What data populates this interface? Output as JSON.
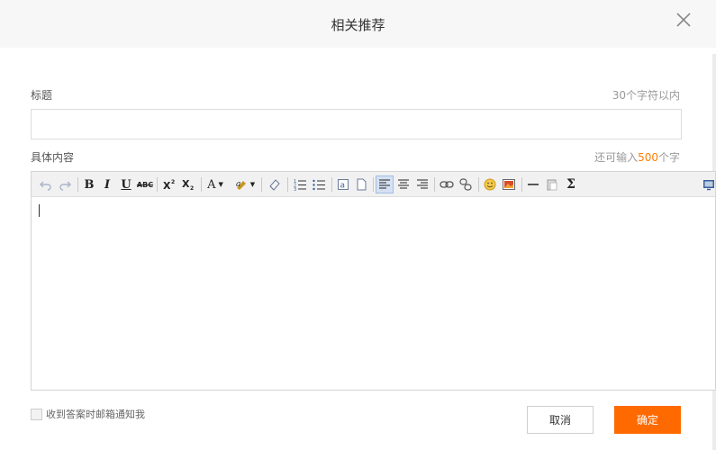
{
  "dialog": {
    "title": "相关推荐",
    "close_icon": "close-icon"
  },
  "form": {
    "title_label": "标题",
    "title_hint": "30个字符以内",
    "title_value": "",
    "content_label": "具体内容",
    "content_hint_prefix": "还可输入",
    "content_hint_count": "500",
    "content_hint_suffix": "个字",
    "content_value": ""
  },
  "toolbar": {
    "bold": "B",
    "italic": "I",
    "underline": "U",
    "strike": "ABC",
    "font_color": "A",
    "sum": "Σ",
    "icons": [
      "undo-icon",
      "redo-icon",
      "bold-icon",
      "italic-icon",
      "underline-icon",
      "strikethrough-icon",
      "superscript-icon",
      "subscript-icon",
      "font-color-icon",
      "highlight-icon",
      "eraser-icon",
      "ordered-list-icon",
      "unordered-list-icon",
      "insert-code-icon",
      "page-icon",
      "align-left-icon",
      "align-center-icon",
      "align-right-icon",
      "link-icon",
      "unlink-icon",
      "emoji-icon",
      "image-icon",
      "horizontal-rule-icon",
      "paste-icon",
      "formula-icon",
      "fullscreen-icon"
    ]
  },
  "notify": {
    "label": "收到答案时邮箱通知我",
    "checked": false
  },
  "actions": {
    "cancel_label": "取消",
    "ok_label": "确定"
  },
  "colors": {
    "accent": "#ff6a00",
    "count_highlight": "#ff7e00",
    "header_bg": "#f7f7f7"
  }
}
